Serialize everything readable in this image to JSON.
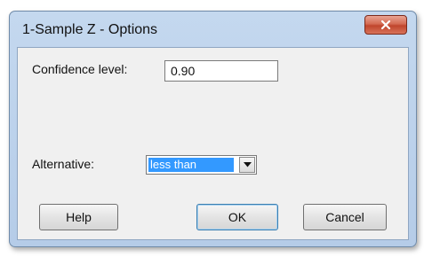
{
  "window": {
    "title": "1-Sample Z - Options",
    "close_icon": "close-icon"
  },
  "form": {
    "confidence_label": "Confidence level:",
    "confidence_value": "0.90",
    "alternative_label": "Alternative:",
    "alternative_value": "less than",
    "dropdown_icon": "chevron-down-icon"
  },
  "buttons": {
    "help": "Help",
    "ok": "OK",
    "cancel": "Cancel"
  },
  "colors": {
    "selection_highlight": "#3399ff",
    "close_button": "#c0452c",
    "title_bar": "#b5cce8"
  }
}
